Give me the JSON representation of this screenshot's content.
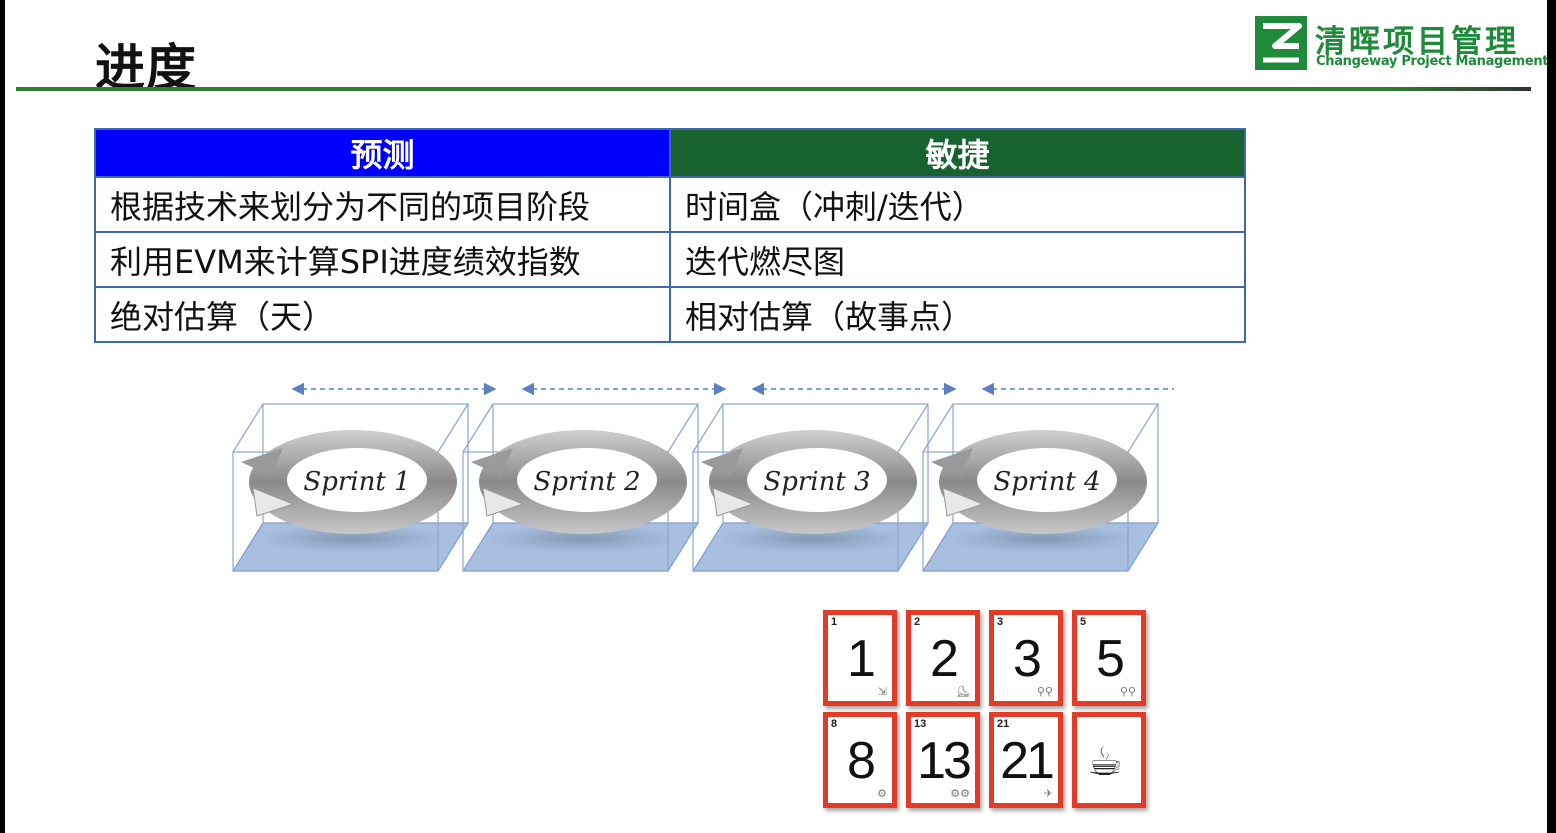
{
  "slide": {
    "title": "进度",
    "logo": {
      "name_cn": "清晖项目管理",
      "name_en": "Changeway Project Management"
    }
  },
  "table": {
    "headers": [
      "预测",
      "敏捷"
    ],
    "rows": [
      [
        "根据技术来划分为不同的项目阶段",
        "时间盒（冲刺/迭代）"
      ],
      [
        "利用EVM来计算SPI进度绩效指数",
        "迭代燃尽图"
      ],
      [
        "绝对估算（天）",
        "相对估算（故事点）"
      ]
    ]
  },
  "sprints": [
    "Sprint 1",
    "Sprint 2",
    "Sprint 3",
    "Sprint 4"
  ],
  "cards": [
    {
      "corner": "1",
      "value": "1",
      "icon": "scooter-icon"
    },
    {
      "corner": "2",
      "value": "2",
      "icon": "kick-scooter-icon"
    },
    {
      "corner": "3",
      "value": "3",
      "icon": "bicycle-icon"
    },
    {
      "corner": "5",
      "value": "5",
      "icon": "bicycle-icon"
    },
    {
      "corner": "8",
      "value": "8",
      "icon": "moped-icon"
    },
    {
      "corner": "13",
      "value": "13",
      "icon": "motorcycle-icon"
    },
    {
      "corner": "21",
      "value": "21",
      "icon": "airplane-icon"
    },
    {
      "corner": "",
      "value": "",
      "icon": "coffee-break-icon"
    }
  ],
  "colors": {
    "predictive_header": "#0000ff",
    "agile_header": "#17622f",
    "brand_green": "#1e8a3a",
    "card_red": "#e23b28",
    "table_border": "#3f68b0"
  }
}
